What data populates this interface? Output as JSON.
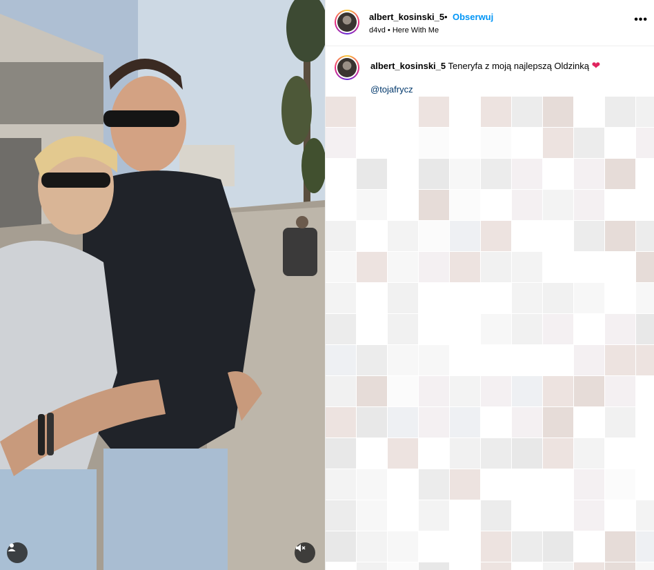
{
  "header": {
    "username": "albert_kosinski_5",
    "separator": "•",
    "follow_label": "Obserwuj",
    "audio_artist": "d4vd",
    "audio_separator": "•",
    "audio_title": "Here With Me",
    "more_label": "•••"
  },
  "caption": {
    "username": "albert_kosinski_5",
    "text": "Teneryfa z moją najlepszą Oldzinką",
    "emoji": "❤",
    "mention": "@tojafrycz"
  },
  "media": {
    "user_tag_icon": "person-icon",
    "mute_icon": "speaker-muted-icon"
  },
  "colors": {
    "accent": "#0095f6",
    "mention": "#00376b",
    "heart": "#e0245e"
  }
}
